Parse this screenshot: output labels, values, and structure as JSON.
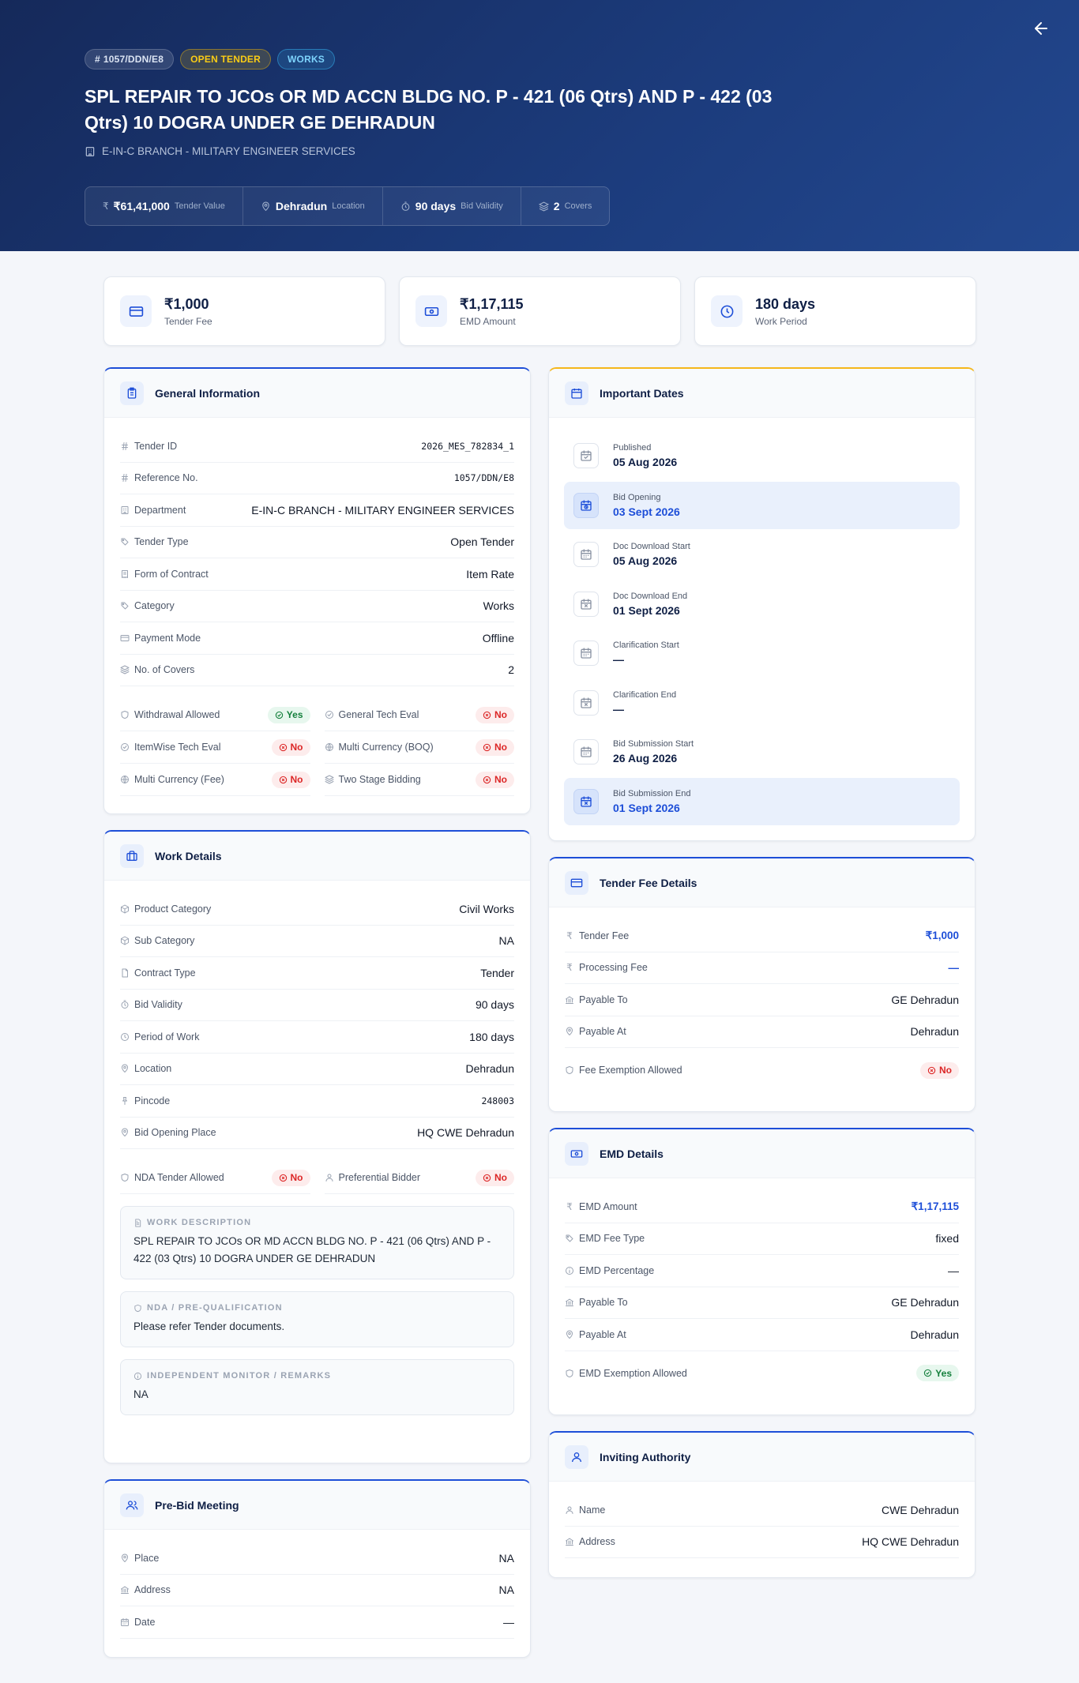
{
  "hero": {
    "ref_badge": "1057/DDN/E8",
    "type_badge": "OPEN TENDER",
    "category_badge": "WORKS",
    "title": "SPL REPAIR TO JCOs OR MD ACCN BLDG NO. P - 421 (06 Qtrs) AND P - 422 (03 Qtrs) 10 DOGRA UNDER GE DEHRADUN",
    "department": "E-IN-C BRANCH - MILITARY ENGINEER SERVICES",
    "stats": [
      {
        "icon": "rupee-icon",
        "value": "₹61,41,000",
        "label": "Tender Value"
      },
      {
        "icon": "map-pin-icon",
        "value": "Dehradun",
        "label": "Location"
      },
      {
        "icon": "timer-icon",
        "value": "90 days",
        "label": "Bid Validity"
      },
      {
        "icon": "layers-icon",
        "value": "2",
        "label": "Covers"
      }
    ]
  },
  "summary": [
    {
      "icon": "credit-card-icon",
      "value": "₹1,000",
      "label": "Tender Fee"
    },
    {
      "icon": "banknote-icon",
      "value": "₹1,17,115",
      "label": "EMD Amount"
    },
    {
      "icon": "clock-icon",
      "value": "180 days",
      "label": "Work Period"
    }
  ],
  "general": {
    "title": "General Information",
    "rows": [
      {
        "icon": "hash-icon",
        "label": "Tender ID",
        "value": "2026_MES_782834_1"
      },
      {
        "icon": "hash-icon",
        "label": "Reference No.",
        "value": "1057/DDN/E8"
      },
      {
        "icon": "building-icon",
        "label": "Department",
        "value": "E-IN-C BRANCH - MILITARY ENGINEER SERVICES"
      },
      {
        "icon": "tag-icon",
        "label": "Tender Type",
        "value": "Open Tender"
      },
      {
        "icon": "receipt-icon",
        "label": "Form of Contract",
        "value": "Item Rate"
      },
      {
        "icon": "tag-icon",
        "label": "Category",
        "value": "Works"
      },
      {
        "icon": "credit-card-icon",
        "label": "Payment Mode",
        "value": "Offline"
      },
      {
        "icon": "layers-icon",
        "label": "No. of Covers",
        "value": "2"
      }
    ],
    "flags": [
      {
        "icon": "shield-icon",
        "label": "Withdrawal Allowed",
        "value": "Yes"
      },
      {
        "icon": "check-circle-icon",
        "label": "General Tech Eval",
        "value": "No"
      },
      {
        "icon": "check-circle-icon",
        "label": "ItemWise Tech Eval",
        "value": "No"
      },
      {
        "icon": "globe-icon",
        "label": "Multi Currency (BOQ)",
        "value": "No"
      },
      {
        "icon": "globe-icon",
        "label": "Multi Currency (Fee)",
        "value": "No"
      },
      {
        "icon": "layers-icon",
        "label": "Two Stage Bidding",
        "value": "No"
      }
    ]
  },
  "work": {
    "title": "Work Details",
    "rows": [
      {
        "icon": "package-icon",
        "label": "Product Category",
        "value": "Civil Works"
      },
      {
        "icon": "package-icon",
        "label": "Sub Category",
        "value": "NA"
      },
      {
        "icon": "file-icon",
        "label": "Contract Type",
        "value": "Tender"
      },
      {
        "icon": "timer-icon",
        "label": "Bid Validity",
        "value": "90 days"
      },
      {
        "icon": "clock-icon",
        "label": "Period of Work",
        "value": "180 days"
      },
      {
        "icon": "map-pin-icon",
        "label": "Location",
        "value": "Dehradun"
      },
      {
        "icon": "pin-icon",
        "label": "Pincode",
        "value": "248003"
      },
      {
        "icon": "map-pin-icon",
        "label": "Bid Opening Place",
        "value": "HQ CWE Dehradun"
      }
    ],
    "flags": [
      {
        "icon": "shield-icon",
        "label": "NDA Tender Allowed",
        "value": "No"
      },
      {
        "icon": "user-icon",
        "label": "Preferential Bidder",
        "value": "No"
      }
    ],
    "boxes": [
      {
        "icon": "file-text-icon",
        "title": "WORK DESCRIPTION",
        "value": "SPL REPAIR TO JCOs OR MD ACCN BLDG NO. P - 421 (06 Qtrs) AND P - 422 (03 Qtrs) 10 DOGRA UNDER GE DEHRADUN"
      },
      {
        "icon": "shield-icon",
        "title": "NDA / PRE-QUALIFICATION",
        "value": "Please refer Tender documents."
      },
      {
        "icon": "info-icon",
        "title": "INDEPENDENT MONITOR / REMARKS",
        "value": "NA"
      }
    ]
  },
  "prebid": {
    "title": "Pre-Bid Meeting",
    "rows": [
      {
        "icon": "map-pin-icon",
        "label": "Place",
        "value": "NA"
      },
      {
        "icon": "bank-icon",
        "label": "Address",
        "value": "NA"
      },
      {
        "icon": "calendar-icon",
        "label": "Date",
        "value": "—"
      }
    ]
  },
  "dates": {
    "title": "Important Dates",
    "items": [
      {
        "icon": "calendar-check-icon",
        "label": "Published",
        "value": "05 Aug 2026"
      },
      {
        "icon": "calendar-clock-icon",
        "label": "Bid Opening",
        "value": "03 Sept 2026"
      },
      {
        "icon": "calendar-icon",
        "label": "Doc Download Start",
        "value": "05 Aug 2026"
      },
      {
        "icon": "calendar-x-icon",
        "label": "Doc Download End",
        "value": "01 Sept 2026"
      },
      {
        "icon": "calendar-icon",
        "label": "Clarification Start",
        "value": "—"
      },
      {
        "icon": "calendar-x-icon",
        "label": "Clarification End",
        "value": "—"
      },
      {
        "icon": "calendar-icon",
        "label": "Bid Submission Start",
        "value": "26 Aug 2026"
      },
      {
        "icon": "calendar-x-icon",
        "label": "Bid Submission End",
        "value": "01 Sept 2026"
      }
    ]
  },
  "fee": {
    "title": "Tender Fee Details",
    "rows": [
      {
        "icon": "rupee-icon",
        "label": "Tender Fee",
        "value": "₹1,000"
      },
      {
        "icon": "rupee-icon",
        "label": "Processing Fee",
        "value": "—"
      },
      {
        "icon": "bank-icon",
        "label": "Payable To",
        "value": "GE Dehradun"
      },
      {
        "icon": "map-pin-icon",
        "label": "Payable At",
        "value": "Dehradun"
      }
    ],
    "flag": {
      "icon": "shield-icon",
      "label": "Fee Exemption Allowed",
      "value": "No"
    }
  },
  "emd": {
    "title": "EMD Details",
    "rows": [
      {
        "icon": "rupee-icon",
        "label": "EMD Amount",
        "value": "₹1,17,115"
      },
      {
        "icon": "tag-icon",
        "label": "EMD Fee Type",
        "value": "fixed"
      },
      {
        "icon": "info-icon",
        "label": "EMD Percentage",
        "value": "—"
      },
      {
        "icon": "bank-icon",
        "label": "Payable To",
        "value": "GE Dehradun"
      },
      {
        "icon": "map-pin-icon",
        "label": "Payable At",
        "value": "Dehradun"
      }
    ],
    "flag": {
      "icon": "shield-icon",
      "label": "EMD Exemption Allowed",
      "value": "Yes"
    }
  },
  "authority": {
    "title": "Inviting Authority",
    "rows": [
      {
        "icon": "user-icon",
        "label": "Name",
        "value": "CWE Dehradun"
      },
      {
        "icon": "bank-icon",
        "label": "Address",
        "value": "HQ CWE Dehradun"
      }
    ]
  },
  "colors": {
    "accent": "#1d4ed8",
    "hero": "#1c3c7d",
    "amber": "#f5b71a",
    "yes": "#15803d",
    "no": "#dc2626"
  }
}
